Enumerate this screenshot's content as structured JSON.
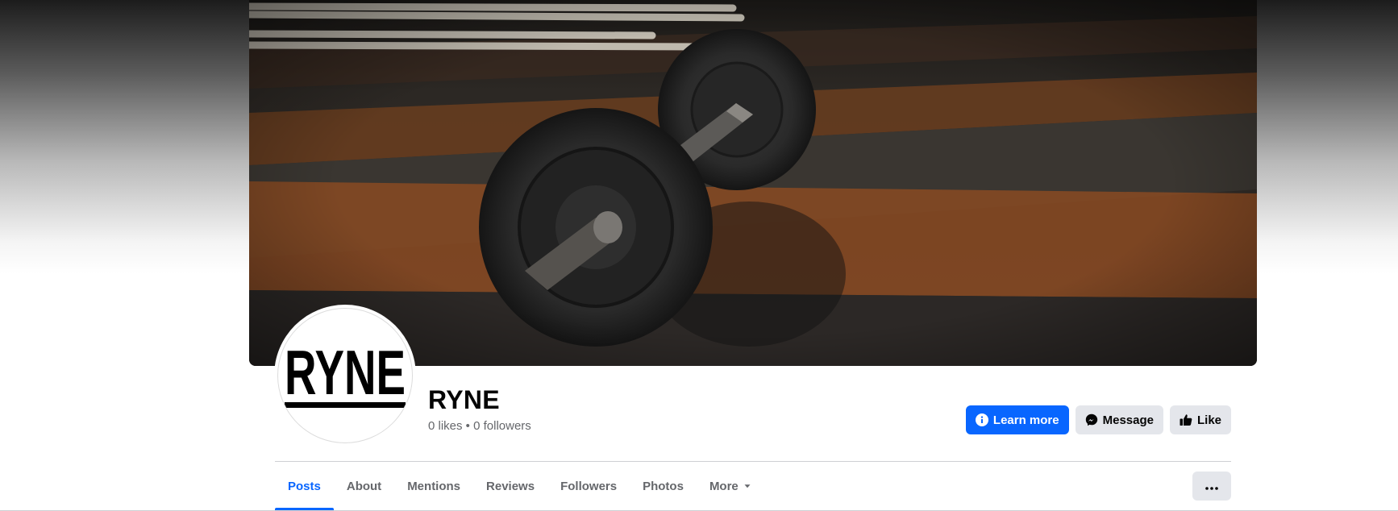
{
  "page": {
    "name": "RYNE",
    "stats": "0 likes • 0 followers",
    "logo_text": "RYNE"
  },
  "actions": {
    "learn_more_label": "Learn more",
    "message_label": "Message",
    "like_label": "Like"
  },
  "tabs": [
    {
      "label": "Posts",
      "active": true
    },
    {
      "label": "About"
    },
    {
      "label": "Mentions"
    },
    {
      "label": "Reviews"
    },
    {
      "label": "Followers"
    },
    {
      "label": "Photos"
    },
    {
      "label": "More"
    }
  ],
  "colors": {
    "accent": "#0866ff",
    "secondary_button": "#e4e6eb",
    "muted_text": "#65676b"
  },
  "icons": {
    "learn_more": "info-icon",
    "message": "messenger-icon",
    "like": "thumbs-up-icon",
    "more": "caret-down-icon",
    "menu": "ellipsis-icon"
  }
}
